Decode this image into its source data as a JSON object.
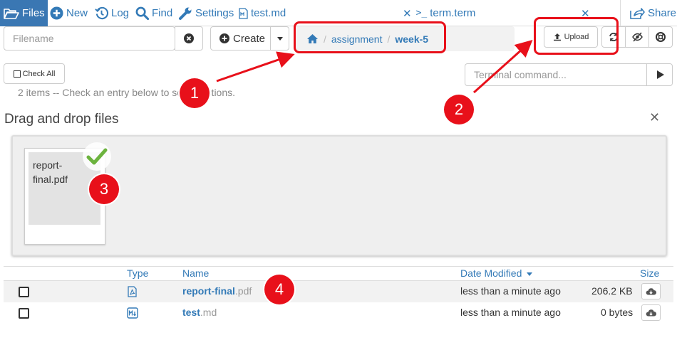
{
  "tabs": {
    "files": "Files",
    "new": "New",
    "log": "Log",
    "find": "Find",
    "settings": "Settings",
    "test_md": "test.md",
    "term": "term.term",
    "share": "Share"
  },
  "toolbar": {
    "filename_placeholder": "Filename",
    "create_label": "Create",
    "upload_label": "Upload",
    "check_all_label": "Check All",
    "terminal_placeholder": "Terminal command..."
  },
  "breadcrumb": {
    "items": [
      "assignment",
      "week-5"
    ]
  },
  "status_hint": "2 items -- Check an entry below to select actions.",
  "dropzone": {
    "title": "Drag and drop files",
    "file_name": "report-final.pdf"
  },
  "table": {
    "headers": {
      "type": "Type",
      "name": "Name",
      "date": "Date Modified",
      "size": "Size"
    },
    "rows": [
      {
        "base": "report-final",
        "ext": ".pdf",
        "modified": "less than a minute ago",
        "size": "206.2 KB",
        "icon": "file-pdf-icon"
      },
      {
        "base": "test",
        "ext": ".md",
        "modified": "less than a minute ago",
        "size": "0 bytes",
        "icon": "markdown-icon"
      }
    ]
  },
  "annotations": {
    "n1": "1",
    "n2": "2",
    "n3": "3",
    "n4": "4"
  },
  "colors": {
    "accent": "#337ab7",
    "annotation_red": "#e8101a",
    "check_green": "#6cb33e"
  }
}
